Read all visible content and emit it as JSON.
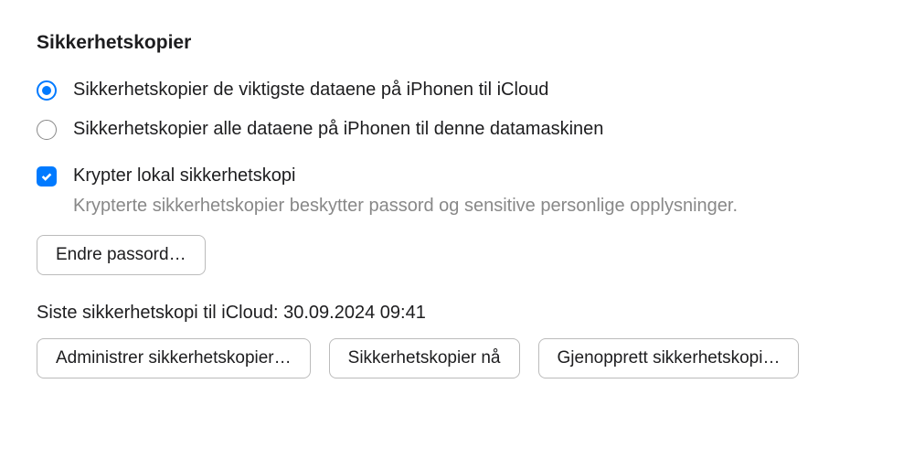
{
  "section": {
    "title": "Sikkerhetskopier"
  },
  "radios": {
    "option1": {
      "label": "Sikkerhetskopier de viktigste dataene på iPhonen til iCloud",
      "selected": true
    },
    "option2": {
      "label": "Sikkerhetskopier alle dataene på iPhonen til denne datamaskinen",
      "selected": false
    }
  },
  "encrypt": {
    "label": "Krypter lokal sikkerhetskopi",
    "helper": "Krypterte sikkerhetskopier beskytter passord og sensitive personlige opplysninger.",
    "checked": true
  },
  "buttons": {
    "changePassword": "Endre passord…",
    "manageBackups": "Administrer sikkerhetskopier…",
    "backupNow": "Sikkerhetskopier nå",
    "restoreBackup": "Gjenopprett sikkerhetskopi…"
  },
  "status": {
    "lastBackup": "Siste sikkerhetskopi til iCloud: 30.09.2024 09:41"
  }
}
